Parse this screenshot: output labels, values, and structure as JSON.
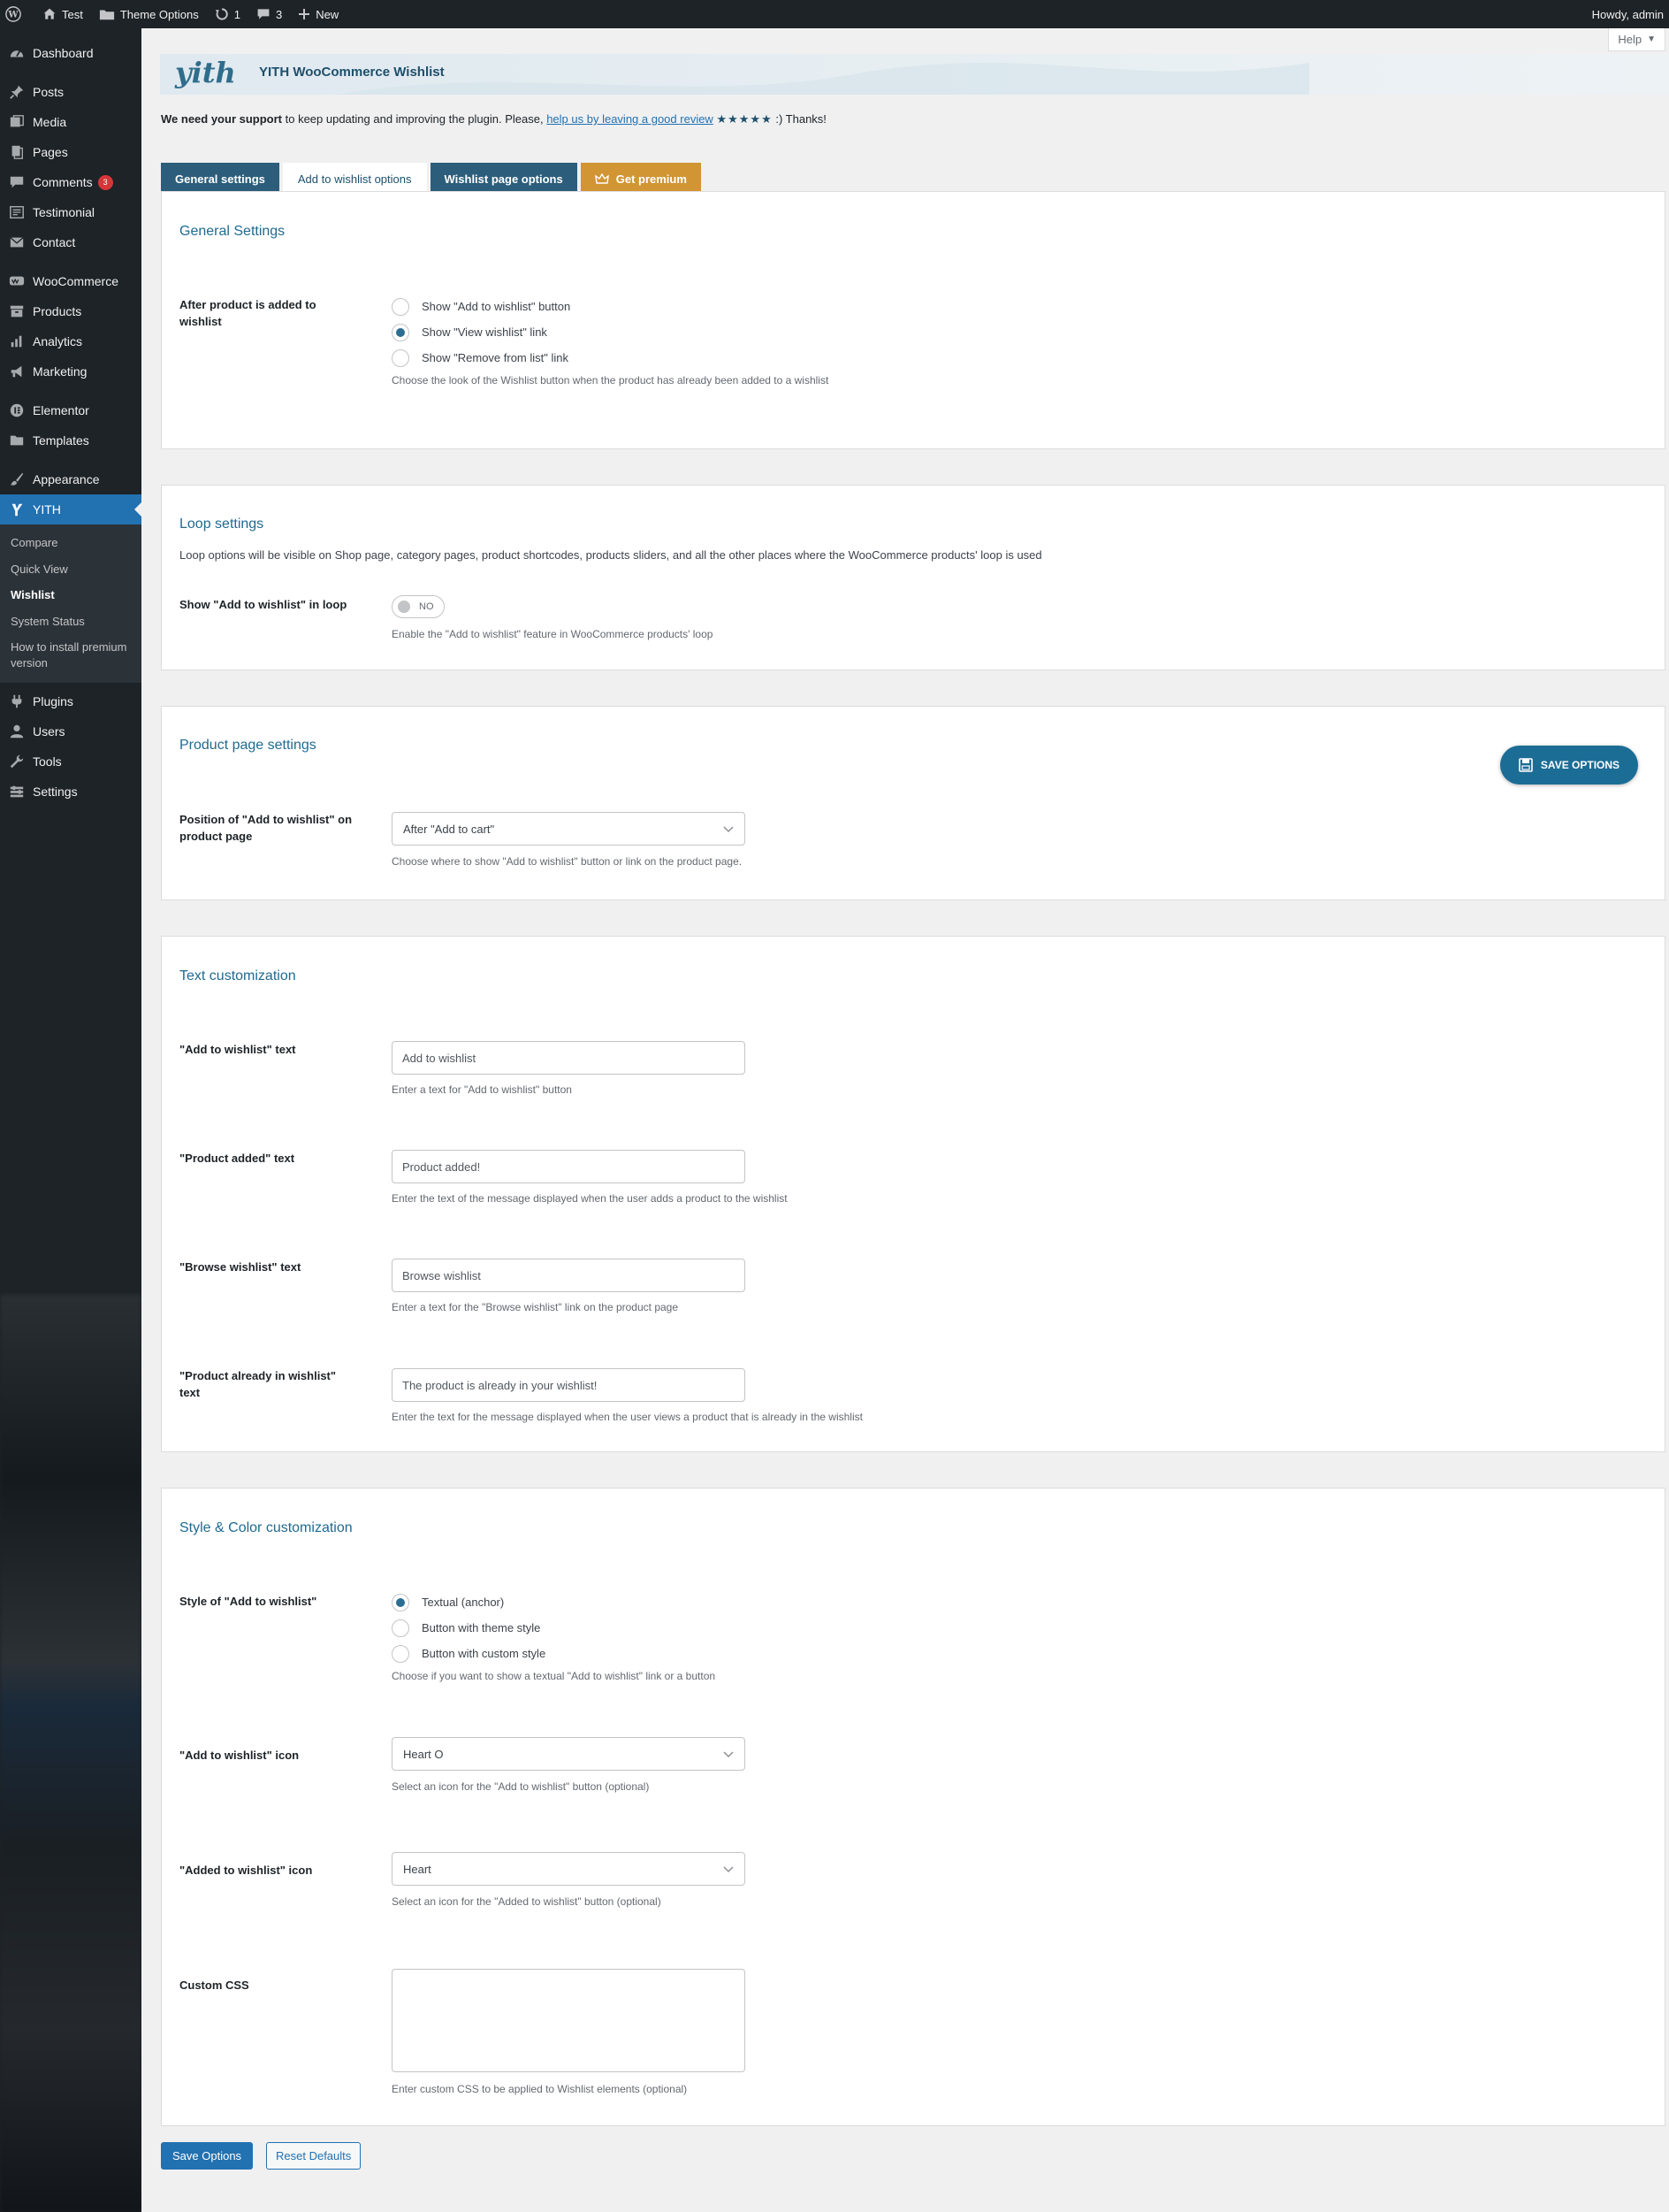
{
  "adminbar": {
    "site_name": "Test",
    "theme_options": "Theme Options",
    "updates_count": "1",
    "comments_count": "3",
    "new_label": "New",
    "howdy": "Howdy, admin"
  },
  "sidebar": {
    "items": [
      {
        "label": "Dashboard",
        "icon": "dashboard-icon"
      },
      {
        "label": "Posts",
        "icon": "pin-icon"
      },
      {
        "label": "Media",
        "icon": "media-icon"
      },
      {
        "label": "Pages",
        "icon": "pages-icon"
      },
      {
        "label": "Comments",
        "icon": "comment-icon",
        "badge": "3"
      },
      {
        "label": "Testimonial",
        "icon": "testimonial-icon"
      },
      {
        "label": "Contact",
        "icon": "mail-icon"
      },
      {
        "label": "WooCommerce",
        "icon": "woo-icon"
      },
      {
        "label": "Products",
        "icon": "archive-icon"
      },
      {
        "label": "Analytics",
        "icon": "chart-icon"
      },
      {
        "label": "Marketing",
        "icon": "megaphone-icon"
      },
      {
        "label": "Elementor",
        "icon": "elementor-icon"
      },
      {
        "label": "Templates",
        "icon": "folder-icon"
      },
      {
        "label": "Appearance",
        "icon": "brush-icon"
      },
      {
        "label": "YITH",
        "icon": "yith-icon"
      },
      {
        "label": "Plugins",
        "icon": "plug-icon"
      },
      {
        "label": "Users",
        "icon": "user-icon"
      },
      {
        "label": "Tools",
        "icon": "wrench-icon"
      },
      {
        "label": "Settings",
        "icon": "settings-icon"
      }
    ],
    "yith_sub": [
      "Compare",
      "Quick View",
      "Wishlist",
      "System Status",
      "How to install premium version"
    ]
  },
  "header": {
    "help_label": "Help",
    "logo_text": "yith",
    "plugin_title": "YITH WooCommerce Wishlist",
    "support_prefix": "We need your support",
    "support_mid": " to keep updating and improving the plugin. Please, ",
    "support_link": "help us by leaving a good review",
    "support_stars": "★★★★★",
    "support_suffix": " :) Thanks!"
  },
  "tabs": {
    "general": "General settings",
    "add_to_wishlist": "Add to wishlist options",
    "wishlist_page": "Wishlist page options",
    "premium": "Get premium"
  },
  "general_settings": {
    "title": "General Settings",
    "after_added_label": "After product is added to wishlist",
    "options": [
      "Show \"Add to wishlist\" button",
      "Show \"View wishlist\" link",
      "Show \"Remove from list\" link"
    ],
    "selected_index": 1,
    "help": "Choose the look of the Wishlist button when the product has already been added to a wishlist"
  },
  "loop_settings": {
    "title": "Loop settings",
    "description": "Loop options will be visible on Shop page, category pages, product shortcodes, products sliders, and all the other places where the WooCommerce products' loop is used",
    "show_in_loop_label": "Show \"Add to wishlist\" in loop",
    "toggle_value": "NO",
    "help": "Enable the \"Add to wishlist\" feature in WooCommerce products' loop"
  },
  "product_page": {
    "title": "Product page settings",
    "position_label": "Position of \"Add to wishlist\" on product page",
    "position_value": "After \"Add to cart\"",
    "help": "Choose where to show \"Add to wishlist\" button or link on the product page.",
    "save_options": "SAVE OPTIONS"
  },
  "text_customization": {
    "title": "Text customization",
    "fields": [
      {
        "label": "\"Add to wishlist\" text",
        "value": "Add to wishlist",
        "help": "Enter a text for \"Add to wishlist\" button"
      },
      {
        "label": "\"Product added\" text",
        "value": "Product added!",
        "help": "Enter the text of the message displayed when the user adds a product to the wishlist"
      },
      {
        "label": "\"Browse wishlist\" text",
        "value": "Browse wishlist",
        "help": "Enter a text for the \"Browse wishlist\" link on the product page"
      },
      {
        "label": "\"Product already in wishlist\" text",
        "value": "The product is already in your wishlist!",
        "help": "Enter the text for the message displayed when the user views a product that is already in the wishlist"
      }
    ]
  },
  "style_color": {
    "title": "Style & Color customization",
    "style_label": "Style of \"Add to wishlist\"",
    "style_options": [
      "Textual (anchor)",
      "Button with theme style",
      "Button with custom style"
    ],
    "style_selected_index": 0,
    "style_help": "Choose if you want to show a textual \"Add to wishlist\" link or a button",
    "add_icon_label": "\"Add to wishlist\" icon",
    "add_icon_value": "Heart O",
    "add_icon_help": "Select an icon for the \"Add to wishlist\" button (optional)",
    "added_icon_label": "\"Added to wishlist\" icon",
    "added_icon_value": "Heart",
    "added_icon_help": "Select an icon for the \"Added to wishlist\" button (optional)",
    "custom_css_label": "Custom CSS",
    "custom_css_value": "",
    "custom_css_help": "Enter custom CSS to be applied to Wishlist elements (optional)"
  },
  "footer_buttons": {
    "save": "Save Options",
    "reset": "Reset Defaults"
  },
  "colors": {
    "accent": "#2271b1",
    "heading": "#1f6a91",
    "tab_dark": "#2c5e7b",
    "premium": "#d19534",
    "adminbar": "#1d2327"
  }
}
